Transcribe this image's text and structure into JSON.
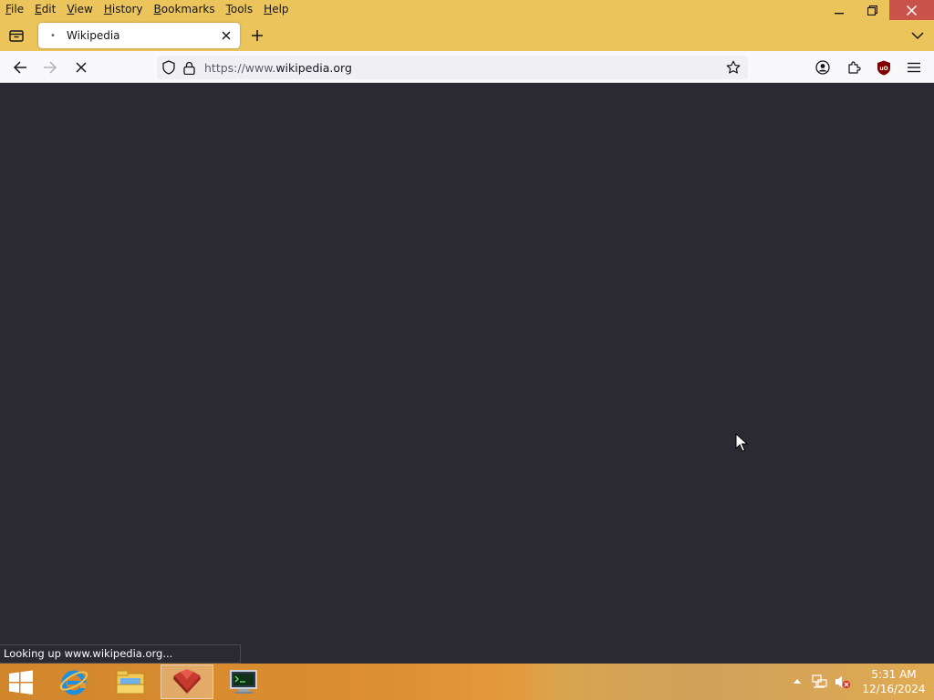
{
  "menubar": {
    "items": [
      {
        "label_ul": "F",
        "label_rest": "ile"
      },
      {
        "label_ul": "E",
        "label_rest": "dit"
      },
      {
        "label_ul": "V",
        "label_rest": "iew"
      },
      {
        "label_ul": "H",
        "label_rest": "istory"
      },
      {
        "label_ul": "B",
        "label_rest": "ookmarks"
      },
      {
        "label_ul": "T",
        "label_rest": "ools"
      },
      {
        "label_ul": "H",
        "label_rest": "elp"
      }
    ]
  },
  "tab": {
    "title": "Wikipedia",
    "favicon": "•"
  },
  "navbar": {
    "url_prefix": "https://www.",
    "url_host": "wikipedia.org"
  },
  "status": {
    "text": "Looking up www.wikipedia.org..."
  },
  "taskbar": {
    "time": "5:31 AM",
    "date": "12/16/2024"
  },
  "colors": {
    "menubar_bg": "#ebc55b",
    "close_button": "#c9524a",
    "content_bg": "#2b2a33",
    "toolbar_bg": "#f9f9fb"
  },
  "icons": {
    "tab_list": "tab-list-icon",
    "back": "back-arrow-icon",
    "forward": "forward-arrow-icon",
    "stop": "stop-icon",
    "shield": "tracking-shield-icon",
    "lock": "lock-icon",
    "bookmark": "star-icon",
    "account": "account-icon",
    "extensions": "puzzle-icon",
    "ublock": "ublock-origin-icon",
    "menu": "hamburger-menu-icon"
  }
}
